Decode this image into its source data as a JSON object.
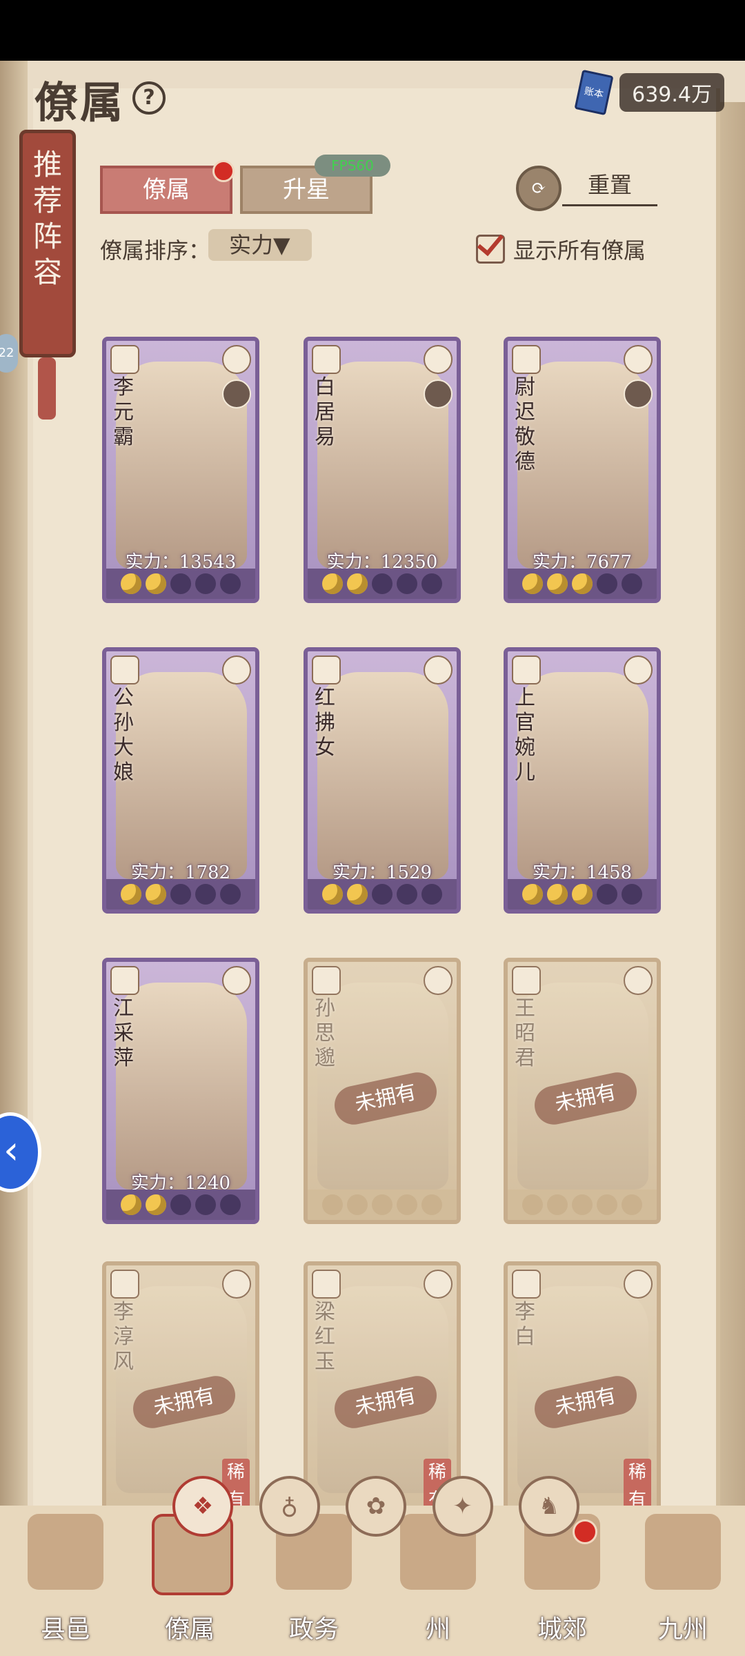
{
  "header": {
    "title": "僚属",
    "help_icon": "?",
    "currency": "639.4万",
    "currency_book_label": "账本"
  },
  "banner": {
    "text": "推荐阵容"
  },
  "fps": "FPS60",
  "tabs": [
    {
      "label": "僚属",
      "active": true
    },
    {
      "label": "升星",
      "active": false
    }
  ],
  "reset": {
    "label": "重置"
  },
  "sort": {
    "label": "僚属排序：",
    "value": "实力▼"
  },
  "show_all": {
    "label": "显示所有僚属",
    "checked": true
  },
  "cards": [
    {
      "name": "李元霸",
      "power": "实力：13543",
      "owned": true,
      "stars": 2
    },
    {
      "name": "白居易",
      "power": "实力：12350",
      "owned": true,
      "stars": 2
    },
    {
      "name": "尉迟敬德",
      "power": "实力：7677",
      "owned": true,
      "stars": 3
    },
    {
      "name": "公孙大娘",
      "power": "实力：1782",
      "owned": true,
      "stars": 2
    },
    {
      "name": "红拂女",
      "power": "实力：1529",
      "owned": true,
      "stars": 2
    },
    {
      "name": "上官婉儿",
      "power": "实力：1458",
      "owned": true,
      "stars": 3
    },
    {
      "name": "江采萍",
      "power": "实力：1240",
      "owned": true,
      "stars": 2
    },
    {
      "name": "孙思邈",
      "power": "",
      "owned": false,
      "unowned_label": "未拥有",
      "stars": 0
    },
    {
      "name": "王昭君",
      "power": "",
      "owned": false,
      "unowned_label": "未拥有",
      "stars": 0
    },
    {
      "name": "李淳风",
      "power": "",
      "owned": false,
      "unowned_label": "未拥有",
      "rare_label": "稀有"
    },
    {
      "name": "梁红玉",
      "power": "",
      "owned": false,
      "unowned_label": "未拥有",
      "rare_label": "稀有"
    },
    {
      "name": "李白",
      "power": "",
      "owned": false,
      "unowned_label": "未拥有",
      "rare_label": "稀有"
    }
  ],
  "filters": [
    {
      "icon": "all-icon",
      "glyph": "❖",
      "active": true
    },
    {
      "icon": "bell-icon",
      "glyph": "♁",
      "active": false
    },
    {
      "icon": "gourd-icon",
      "glyph": "✿",
      "active": false
    },
    {
      "icon": "fan-icon",
      "glyph": "✦",
      "active": false
    },
    {
      "icon": "beast-icon",
      "glyph": "♞",
      "active": false
    }
  ],
  "bottom_nav": [
    {
      "label": "县邑",
      "icon": "county-icon",
      "active": false,
      "dot": false
    },
    {
      "label": "僚属",
      "icon": "staff-icon",
      "active": true,
      "dot": false
    },
    {
      "label": "政务",
      "icon": "affairs-icon",
      "active": false,
      "dot": false
    },
    {
      "label": "州",
      "icon": "state-icon",
      "active": false,
      "dot": false
    },
    {
      "label": "城郊",
      "icon": "outskirts-icon",
      "active": false,
      "dot": true
    },
    {
      "label": "九州",
      "icon": "map-icon",
      "active": false,
      "dot": false
    }
  ],
  "colors": {
    "accent": "#b03c33",
    "owned_frame": "#7a5f96",
    "paper": "#efe4d0"
  }
}
